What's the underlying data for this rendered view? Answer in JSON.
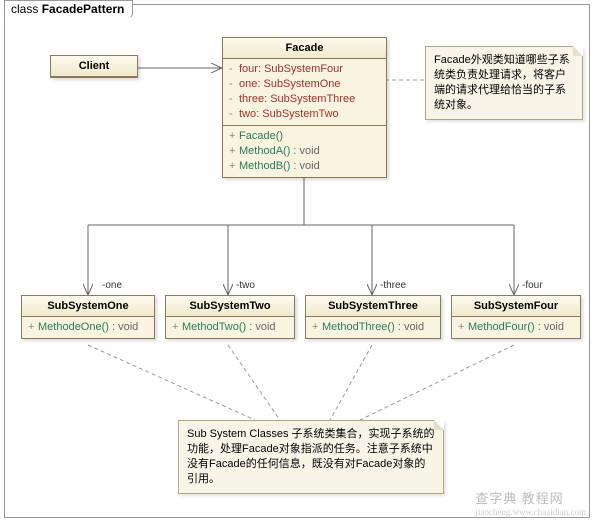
{
  "frame": {
    "label_prefix": "class ",
    "label_name": "FacadePattern"
  },
  "client": {
    "name": "Client"
  },
  "facade": {
    "name": "Facade",
    "attrs": [
      {
        "vis": "-",
        "name": "four",
        "type": "SubSystemFour"
      },
      {
        "vis": "-",
        "name": "one",
        "type": "SubSystemOne"
      },
      {
        "vis": "-",
        "name": "three",
        "type": "SubSystemThree"
      },
      {
        "vis": "-",
        "name": "two",
        "type": "SubSystemTwo"
      }
    ],
    "ops": [
      {
        "vis": "+",
        "sig": "Facade()",
        "ret": ""
      },
      {
        "vis": "+",
        "sig": "MethodA()",
        "ret": "void"
      },
      {
        "vis": "+",
        "sig": "MethodB()",
        "ret": "void"
      }
    ]
  },
  "subs": [
    {
      "name": "SubSystemOne",
      "op": {
        "vis": "+",
        "sig": "MethodeOne()",
        "ret": "void"
      },
      "role": "-one"
    },
    {
      "name": "SubSystemTwo",
      "op": {
        "vis": "+",
        "sig": "MethodTwo()",
        "ret": "void"
      },
      "role": "-two"
    },
    {
      "name": "SubSystemThree",
      "op": {
        "vis": "+",
        "sig": "MethodThree()",
        "ret": "void"
      },
      "role": "-three"
    },
    {
      "name": "SubSystemFour",
      "op": {
        "vis": "+",
        "sig": "MethodFour()",
        "ret": "void"
      },
      "role": "-four"
    }
  ],
  "note_facade": "Facade外观类知道哪些子系统类负责处理请求，将客户端的请求代理给恰当的子系统对象。",
  "note_subs": "Sub System Classes 子系统类集合，实现子系统的功能，处理Facade对象指派的任务。注意子系统中没有Facade的任何信息，既没有对Facade对象的引用。",
  "watermark": {
    "main": "查字典 教程网",
    "sub": "jiaocheng.www.chazidian.com"
  }
}
